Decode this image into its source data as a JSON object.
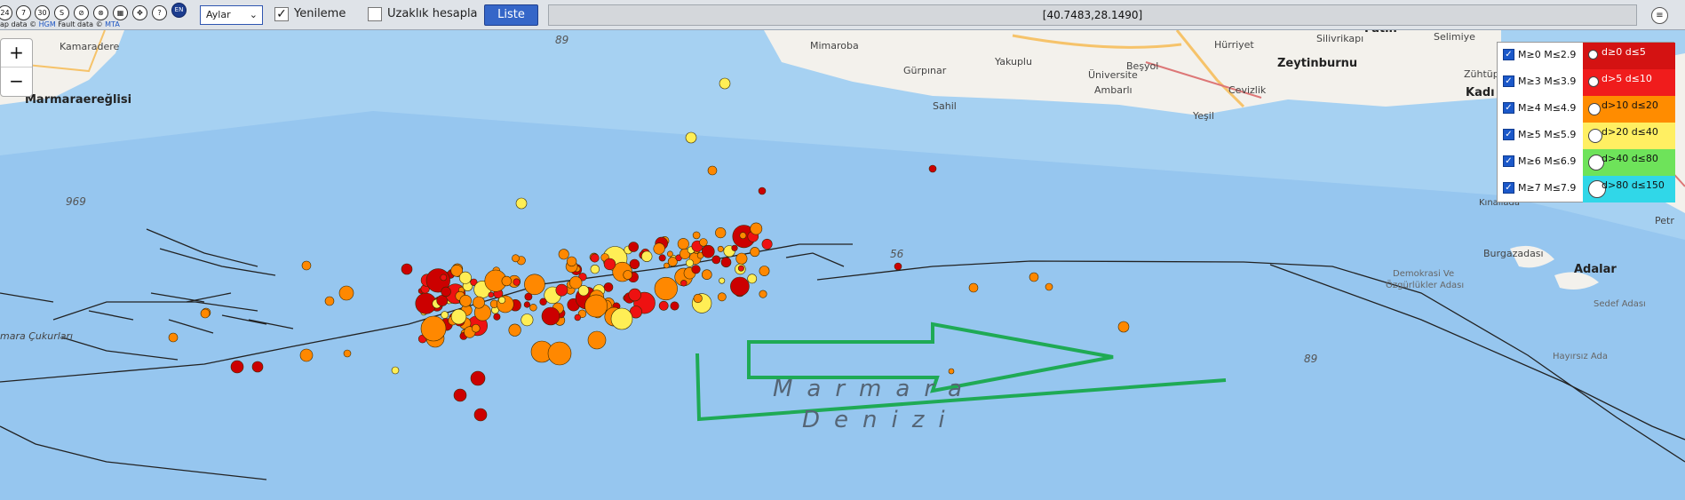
{
  "toolbar": {
    "icons": [
      {
        "name": "24h-icon",
        "label": "24"
      },
      {
        "name": "7day-icon",
        "label": "7"
      },
      {
        "name": "30day-icon",
        "label": "30"
      },
      {
        "name": "s-icon",
        "label": "S"
      },
      {
        "name": "fault-toggle-icon",
        "label": "⊘"
      },
      {
        "name": "no-layer-icon",
        "label": "⊗"
      },
      {
        "name": "grid-icon",
        "label": "▦"
      },
      {
        "name": "crosshair-icon",
        "label": "✥"
      },
      {
        "name": "help-icon",
        "label": "?"
      },
      {
        "name": "language-en-icon",
        "label": "EN"
      }
    ],
    "attribution_prefix": "ap data © ",
    "attribution_hgm": "HGM",
    "attribution_mid": " Fault data © ",
    "attribution_mta": "MTA",
    "period_select": "Aylar",
    "refresh_label": "Yenileme",
    "refresh_checked": true,
    "distance_label": "Uzaklık hesapla",
    "distance_checked": false,
    "list_button": "Liste",
    "coordinates": "[40.7483,28.1490]",
    "menu_icon": "≡"
  },
  "zoom": {
    "in": "+",
    "out": "−"
  },
  "map_labels": {
    "kamaradere": "Kamaradere",
    "marmaraereglisi": "Marmaraereğlisi",
    "mimaroba": "Mimaroba",
    "gurpinar": "Gürpınar",
    "yakuplu": "Yakuplu",
    "universite": "Üniversite",
    "ambarli": "Ambarlı",
    "sahil": "Sahil",
    "hurriyet": "Hürriyet",
    "besyol": "Beşyol",
    "yesilkoy": "Yeşil",
    "cevizlik": "Cevizlik",
    "zeytinburnu": "Zeytinburnu",
    "fatih": "Fatih",
    "silivrikapi": "Silivrikapı",
    "selimiye": "Selimiye",
    "zuhtupasa": "Zühtüpa",
    "kadikoy": "Kadı",
    "kinaliada": "Kınalıada",
    "burgazadasi": "Burgazadası",
    "demokrasi": "Demokrasi Ve",
    "ozgurlukler": "Özgürlükler Adası",
    "adalar": "Adalar",
    "sedefadasi": "Sedef Adası",
    "hayirsizada": "Hayırsız Ada",
    "petr": "Petr",
    "cukurlari": "mara Çukurları",
    "depth_89a": "89",
    "depth_969": "969",
    "depth_56": "56",
    "depth_89b": "89",
    "sea_line1": "Marmara",
    "sea_line2": "Denizi"
  },
  "legend": {
    "magnitudes": [
      {
        "label": "M≥0  M≤2.9",
        "checked": true
      },
      {
        "label": "M≥3  M≤3.9",
        "checked": true
      },
      {
        "label": "M≥4  M≤4.9",
        "checked": true
      },
      {
        "label": "M≥5  M≤5.9",
        "checked": true
      },
      {
        "label": "M≥6  M≤6.9",
        "checked": true
      },
      {
        "label": "M≥7  M≤7.9",
        "checked": true
      }
    ],
    "depths": [
      {
        "label": "d≥0   d≤5",
        "color": "#d41212"
      },
      {
        "label": "d>5   d≤10",
        "color": "#f01c1c"
      },
      {
        "label": "d>10  d≤20",
        "color": "#ff8c00"
      },
      {
        "label": "d>20  d≤40",
        "color": "#ffef62"
      },
      {
        "label": "d>40  d≤80",
        "color": "#6ee35a"
      },
      {
        "label": "d>80 d≤150",
        "color": "#30d7e8"
      }
    ]
  },
  "colors": {
    "deep_red": "#cc0000",
    "red": "#ee1111",
    "orange": "#ff8800",
    "yellow": "#ffee55",
    "annotation": "#1faa55"
  }
}
